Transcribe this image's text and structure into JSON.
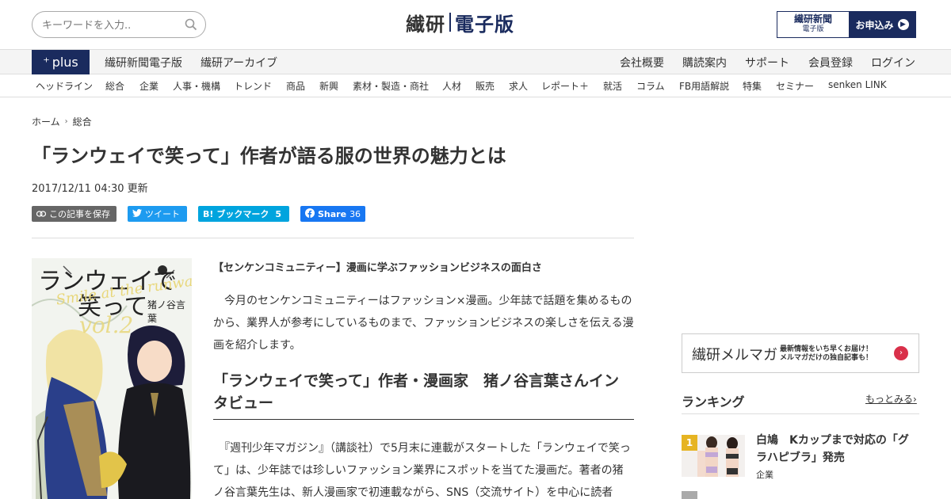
{
  "header": {
    "search_placeholder": "キーワードを入力..",
    "logo_part1": "繊研",
    "logo_part2": "電子版",
    "apply_top": "繊研新聞",
    "apply_sub": "電子版",
    "apply_label": "お申込み"
  },
  "nav": {
    "plus_label": "plus",
    "left_links": [
      "繊研新聞電子版",
      "繊研アーカイブ"
    ],
    "right_links": [
      "会社概要",
      "購読案内",
      "サポート",
      "会員登録",
      "ログイン"
    ]
  },
  "categories": [
    "ヘッドライン",
    "総合",
    "企業",
    "人事・機構",
    "トレンド",
    "商品",
    "新興",
    "素材・製造・商社",
    "人材",
    "販売",
    "求人",
    "レポート＋",
    "就活",
    "コラム",
    "FB用語解説",
    "特集",
    "セミナー",
    "senken LINK"
  ],
  "breadcrumb": [
    "ホーム",
    "総合"
  ],
  "article": {
    "title": "「ランウェイで笑って」作者が語る服の世界の魅力とは",
    "date": "2017/12/11 04:30 更新",
    "save_label": "この記事を保存",
    "tweet_label": "ツイート",
    "hatena_label": "ブックマーク",
    "hatena_count": "5",
    "fb_label": "Share",
    "fb_count": "36",
    "lead": "【センケンコミュニティー】漫画に学ぶファッションビジネスの面白さ",
    "body1": "　今月のセンケンコミュニティーはファッション×漫画。少年誌で話題を集めるものから、業界人が参考にしているものまで、ファッションビジネスの楽しさを伝える漫画を紹介します。",
    "heading": "「ランウェイで笑って」作者・漫画家　猪ノ谷言葉さんインタビュー",
    "body2": "　『週刊少年マガジン』（講談社）で5月末に連載がスタートした「ランウェイで笑って」は、少年誌では珍しいファッション業界にスポットを当てた漫画だ。著者の猪ノ谷言葉先生は、新人漫画家で初連載ながら、SNS（交流サイト）を中心に読者"
  },
  "cover": {
    "title_line1": "ランウェイで",
    "title_line2": "笑って",
    "subtitle": "Smile at the runway",
    "author": "猪ノ谷言葉",
    "volume": "vol.2"
  },
  "sidebar": {
    "mailmag_title": "繊研メルマガ",
    "mailmag_line1": "最新情報をいち早くお届け！",
    "mailmag_line2": "メルマガだけの独自記事も！",
    "ranking_title": "ランキング",
    "more_label": "もっとみる",
    "rank1_num": "1",
    "rank1_title": "白鳩　Kカップまで対応の「グラハピブラ」発売",
    "rank1_cat": "企業"
  },
  "colors": {
    "navy": "#1a2b5e",
    "twitter": "#1d9bf0",
    "hatena": "#00a4de",
    "facebook": "#1877f2",
    "save": "#666666",
    "rank_gold": "#e6b422"
  }
}
